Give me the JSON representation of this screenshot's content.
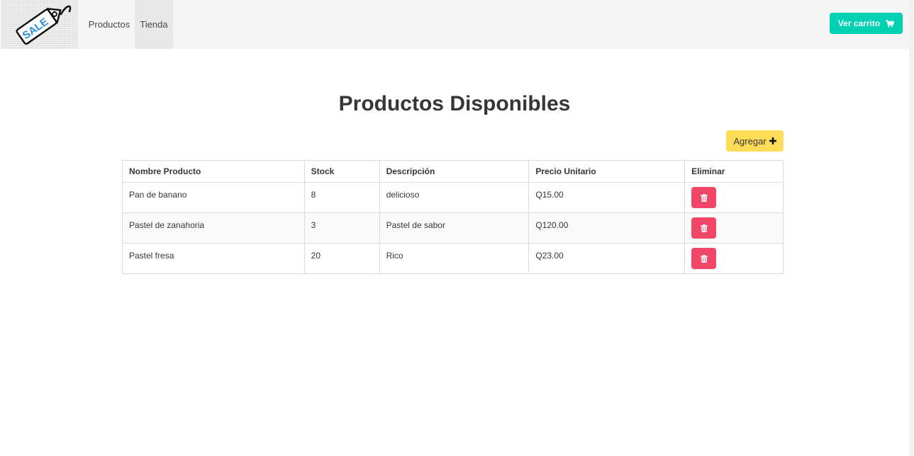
{
  "brand": {
    "logo_text": "SALE",
    "logo_icon": "price-tag-icon"
  },
  "navbar": {
    "items": [
      {
        "label": "Productos"
      },
      {
        "label": "Tienda",
        "active": true
      }
    ],
    "cart_button": {
      "label": "Ver carrito",
      "icon": "shopping-cart-icon",
      "color": "#00d1b2"
    }
  },
  "main": {
    "title": "Productos Disponibles",
    "add_button": {
      "label": "Agregar",
      "icon": "plus-icon",
      "color": "#ffdd57"
    },
    "table": {
      "headers": [
        "Nombre Producto",
        "Stock",
        "Descripción",
        "Precio Unitario",
        "Eliminar"
      ],
      "rows": [
        {
          "name": "Pan de banano",
          "stock": "8",
          "description": "delicioso",
          "price": "Q15.00"
        },
        {
          "name": "Pastel de zanahoria",
          "stock": "3",
          "description": "Pastel de sabor",
          "price": "Q120.00"
        },
        {
          "name": "Pastel fresa",
          "stock": "20",
          "description": "Rico",
          "price": "Q23.00"
        }
      ],
      "delete_icon": "trash-icon",
      "delete_color": "#f14668"
    }
  }
}
